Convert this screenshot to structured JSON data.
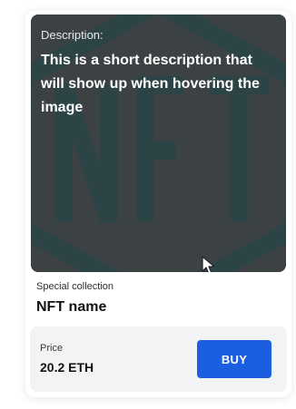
{
  "card": {
    "image": {
      "art_text": "NFT",
      "art_color": "#1b4a4c",
      "overlay": {
        "label": "Description:",
        "text": "This is a short description that will show up when hovering the image"
      }
    },
    "collection": "Special collection",
    "name": "NFT name",
    "price": {
      "label": "Price",
      "value": "20.2 ETH"
    },
    "buy_label": "BUY",
    "accent": "#1c5ee0"
  }
}
